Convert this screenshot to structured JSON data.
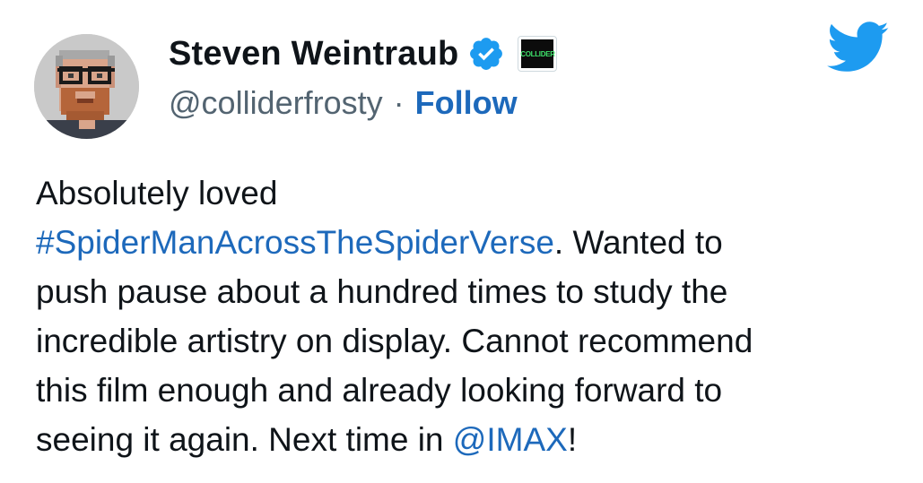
{
  "author": {
    "display_name": "Steven Weintraub",
    "handle": "@colliderfrosty",
    "separator": "·",
    "follow_label": "Follow",
    "avatar_icon": "pixel-art-avatar",
    "verified_icon": "verified-badge-icon",
    "affiliation": {
      "label": "COLLIDER",
      "icon": "collider-affiliate-badge"
    }
  },
  "platform": {
    "logo_icon": "twitter-bird-icon",
    "brand_color": "#1d9bf0"
  },
  "tweet": {
    "line1": "Absolutely loved",
    "hashtag": "#SpiderManAcrossTheSpiderVerse",
    "line2_rest": ". Wanted to",
    "line3": "push pause about a hundred times to study the",
    "line4": "incredible artistry on display. Cannot recommend",
    "line5": "this film enough and already looking forward to",
    "line6_pre": "seeing it again. Next time in ",
    "mention": "@IMAX",
    "line6_post": "!"
  },
  "colors": {
    "text": "#0f1419",
    "secondary": "#536471",
    "link": "#1d69bb"
  }
}
